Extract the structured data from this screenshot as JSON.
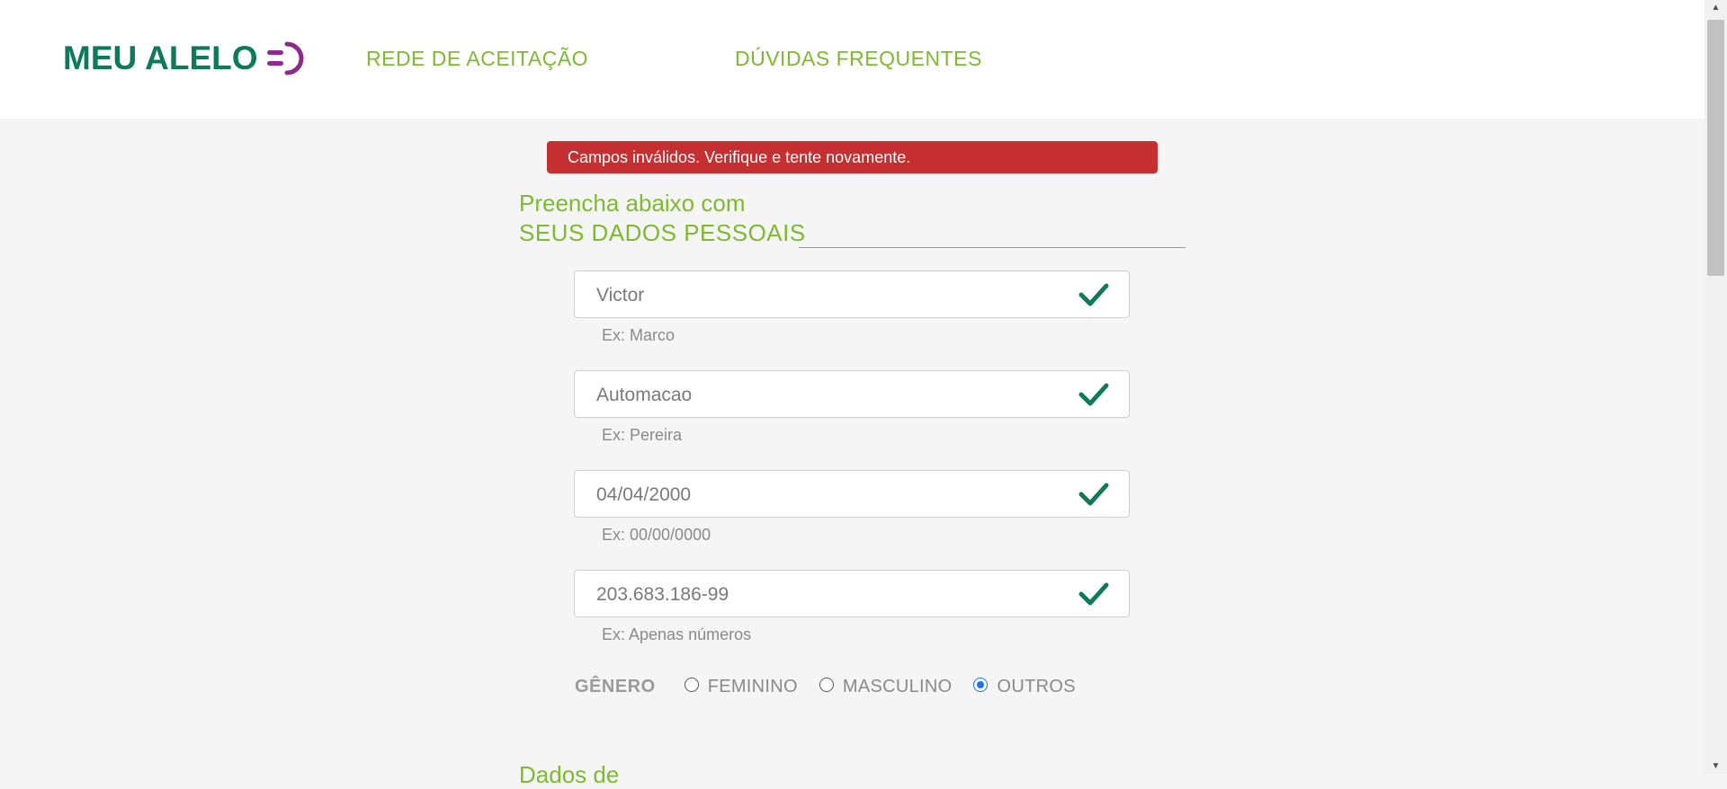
{
  "header": {
    "logo_text": "MEU ALELO",
    "nav": [
      {
        "label": "REDE DE ACEITAÇÃO"
      },
      {
        "label": "DÚVIDAS FREQUENTES"
      }
    ]
  },
  "alert": {
    "message": "Campos inválidos. Verifique e tente novamente."
  },
  "form": {
    "title_line1": "Preencha abaixo com",
    "title_line2": "SEUS DADOS PESSOAIS",
    "fields": [
      {
        "value": "Victor",
        "hint": "Ex: Marco",
        "valid": true
      },
      {
        "value": "Automacao",
        "hint": "Ex: Pereira",
        "valid": true
      },
      {
        "value": "04/04/2000",
        "hint": "Ex: 00/00/0000",
        "valid": true
      },
      {
        "value": "203.683.186-99",
        "hint": "Ex: Apenas números",
        "valid": true
      }
    ],
    "gender": {
      "label": "GÊNERO",
      "options": [
        {
          "label": "FEMININO",
          "selected": false
        },
        {
          "label": "MASCULINO",
          "selected": false
        },
        {
          "label": "OUTROS",
          "selected": true
        }
      ]
    },
    "next_section_partial": "Dados de"
  },
  "colors": {
    "brand_green": "#0f7a5a",
    "accent_green": "#7dba2f",
    "logo_purple": "#8e2a8c",
    "error_red": "#c62f31",
    "radio_blue": "#1a73e8"
  },
  "icons": {
    "logo_mark": "alelo-logo-icon",
    "valid": "check-icon",
    "scroll_up": "arrow-up-icon",
    "scroll_down": "arrow-down-icon"
  }
}
